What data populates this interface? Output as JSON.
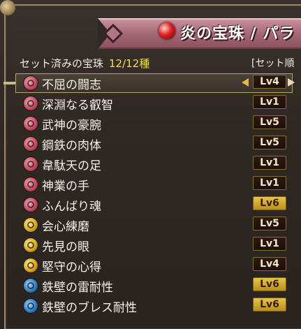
{
  "banner": {
    "title": "炎の宝珠 / パラ",
    "icon": "red-orb-icon"
  },
  "header": {
    "label": "セット済みの宝珠",
    "count": "12/12種",
    "sort": "[セット順"
  },
  "colors": {
    "red": "#c64a62",
    "yellow": "#d6a81e",
    "blue": "#2d7fc4",
    "accent": "#f2e04a"
  },
  "items": [
    {
      "name": "不屈の闘志",
      "level": "Lv4",
      "gem": "red",
      "lv_style": "dark",
      "selected": true
    },
    {
      "name": "深淵なる叡智",
      "level": "Lv1",
      "gem": "red",
      "lv_style": "dark"
    },
    {
      "name": "武神の豪腕",
      "level": "Lv5",
      "gem": "red",
      "lv_style": "dark"
    },
    {
      "name": "鋼鉄の肉体",
      "level": "Lv5",
      "gem": "red",
      "lv_style": "dark"
    },
    {
      "name": "韋駄天の足",
      "level": "Lv1",
      "gem": "red",
      "lv_style": "dark"
    },
    {
      "name": "神業の手",
      "level": "Lv1",
      "gem": "red",
      "lv_style": "dark"
    },
    {
      "name": "ふんばり魂",
      "level": "Lv6",
      "gem": "red",
      "lv_style": "gold"
    },
    {
      "name": "会心練磨",
      "level": "Lv5",
      "gem": "yellow",
      "lv_style": "dark"
    },
    {
      "name": "先見の眼",
      "level": "Lv1",
      "gem": "yellow",
      "lv_style": "dark"
    },
    {
      "name": "堅守の心得",
      "level": "Lv4",
      "gem": "yellow",
      "lv_style": "dark"
    },
    {
      "name": "鉄壁の雷耐性",
      "level": "Lv6",
      "gem": "blue",
      "lv_style": "gold"
    },
    {
      "name": "鉄壁のブレス耐性",
      "level": "Lv6",
      "gem": "blue",
      "lv_style": "gold"
    }
  ]
}
